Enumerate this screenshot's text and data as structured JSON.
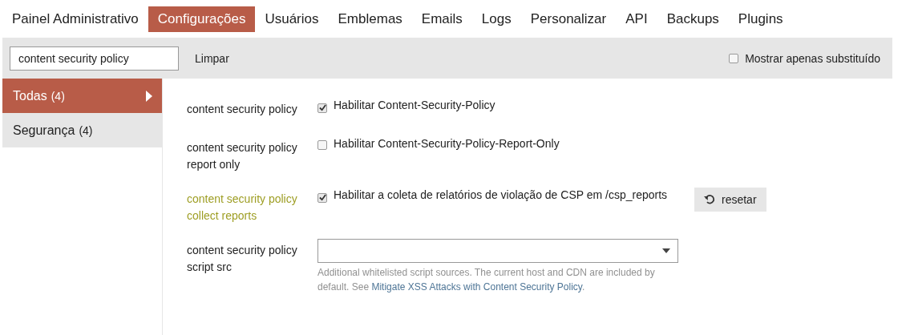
{
  "nav": [
    {
      "label": "Painel Administrativo",
      "selected": false
    },
    {
      "label": "Configurações",
      "selected": true
    },
    {
      "label": "Usuários",
      "selected": false
    },
    {
      "label": "Emblemas",
      "selected": false
    },
    {
      "label": "Emails",
      "selected": false
    },
    {
      "label": "Logs",
      "selected": false
    },
    {
      "label": "Personalizar",
      "selected": false
    },
    {
      "label": "API",
      "selected": false
    },
    {
      "label": "Backups",
      "selected": false
    },
    {
      "label": "Plugins",
      "selected": false
    }
  ],
  "filter": {
    "value": "content security policy",
    "clear_label": "Limpar",
    "only_overridden": {
      "label": "Mostrar apenas substituído",
      "checked": false
    }
  },
  "categories": [
    {
      "label": "Todas",
      "count": "(4)",
      "selected": true
    },
    {
      "label": "Segurança",
      "count": "(4)",
      "selected": false
    }
  ],
  "settings": [
    {
      "kind": "checkbox",
      "name": "content security policy",
      "description": "Habilitar Content-Security-Policy",
      "checked": true,
      "overridden": false
    },
    {
      "kind": "checkbox",
      "name": "content security policy report only",
      "description": "Habilitar Content-Security-Policy-Report-Only",
      "checked": false,
      "overridden": false
    },
    {
      "kind": "checkbox",
      "name": "content security policy collect reports",
      "description": "Habilitar a coleta de relatórios de violação de CSP em /csp_reports",
      "checked": true,
      "overridden": true,
      "reset_label": "resetar"
    },
    {
      "kind": "list",
      "name": "content security policy script src",
      "overridden": false,
      "help_text": "Additional whitelisted script sources. The current host and CDN are included by default. See",
      "help_link": "Mitigate XSS Attacks with Content Security Policy",
      "help_end": "."
    }
  ]
}
